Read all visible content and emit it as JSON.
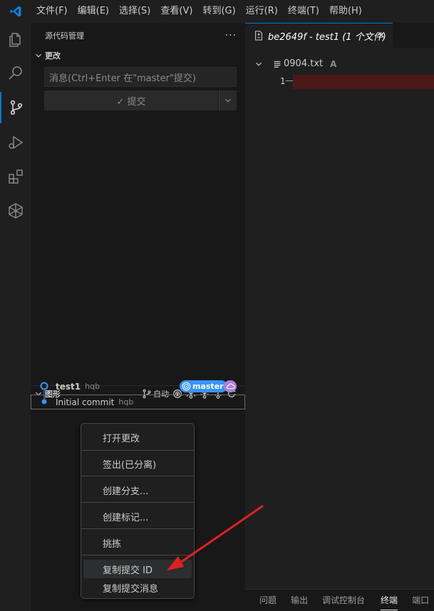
{
  "menu": [
    "文件(F)",
    "编辑(E)",
    "选择(S)",
    "查看(V)",
    "转到(G)",
    "运行(R)",
    "终端(T)",
    "帮助(H)"
  ],
  "sidebar": {
    "title": "源代码管理",
    "more": "···",
    "changes_label": "更改",
    "commit_placeholder": "消息(Ctrl+Enter 在\"master\"提交)",
    "commit_button": "✓ 提交",
    "graph": {
      "label": "图形",
      "auto_label": "自动",
      "commits": [
        {
          "title": "test1",
          "author": "hqb",
          "branch": "master"
        },
        {
          "title": "Initial commit",
          "author": "hqb"
        }
      ]
    }
  },
  "editor": {
    "tab_title": "be2649f - test1 (1 个文件)",
    "file_name": "0904.txt",
    "file_status": "A",
    "line_number": "1",
    "line_marker": "—"
  },
  "panel_tabs": [
    "问题",
    "输出",
    "调试控制台",
    "终端",
    "端口"
  ],
  "active_panel_tab": "终端",
  "context_menu": {
    "items": [
      "打开更改",
      "签出(已分离)",
      "创建分支...",
      "创建标记...",
      "挑拣",
      "复制提交 ID",
      "复制提交消息"
    ],
    "highlighted": "复制提交 ID"
  },
  "colors": {
    "accent": "#0078d4",
    "branch_badge": "#3794ff",
    "remote_badge": "#b180d7",
    "deleted_line": "#4b1818",
    "arrow": "#e02020"
  }
}
